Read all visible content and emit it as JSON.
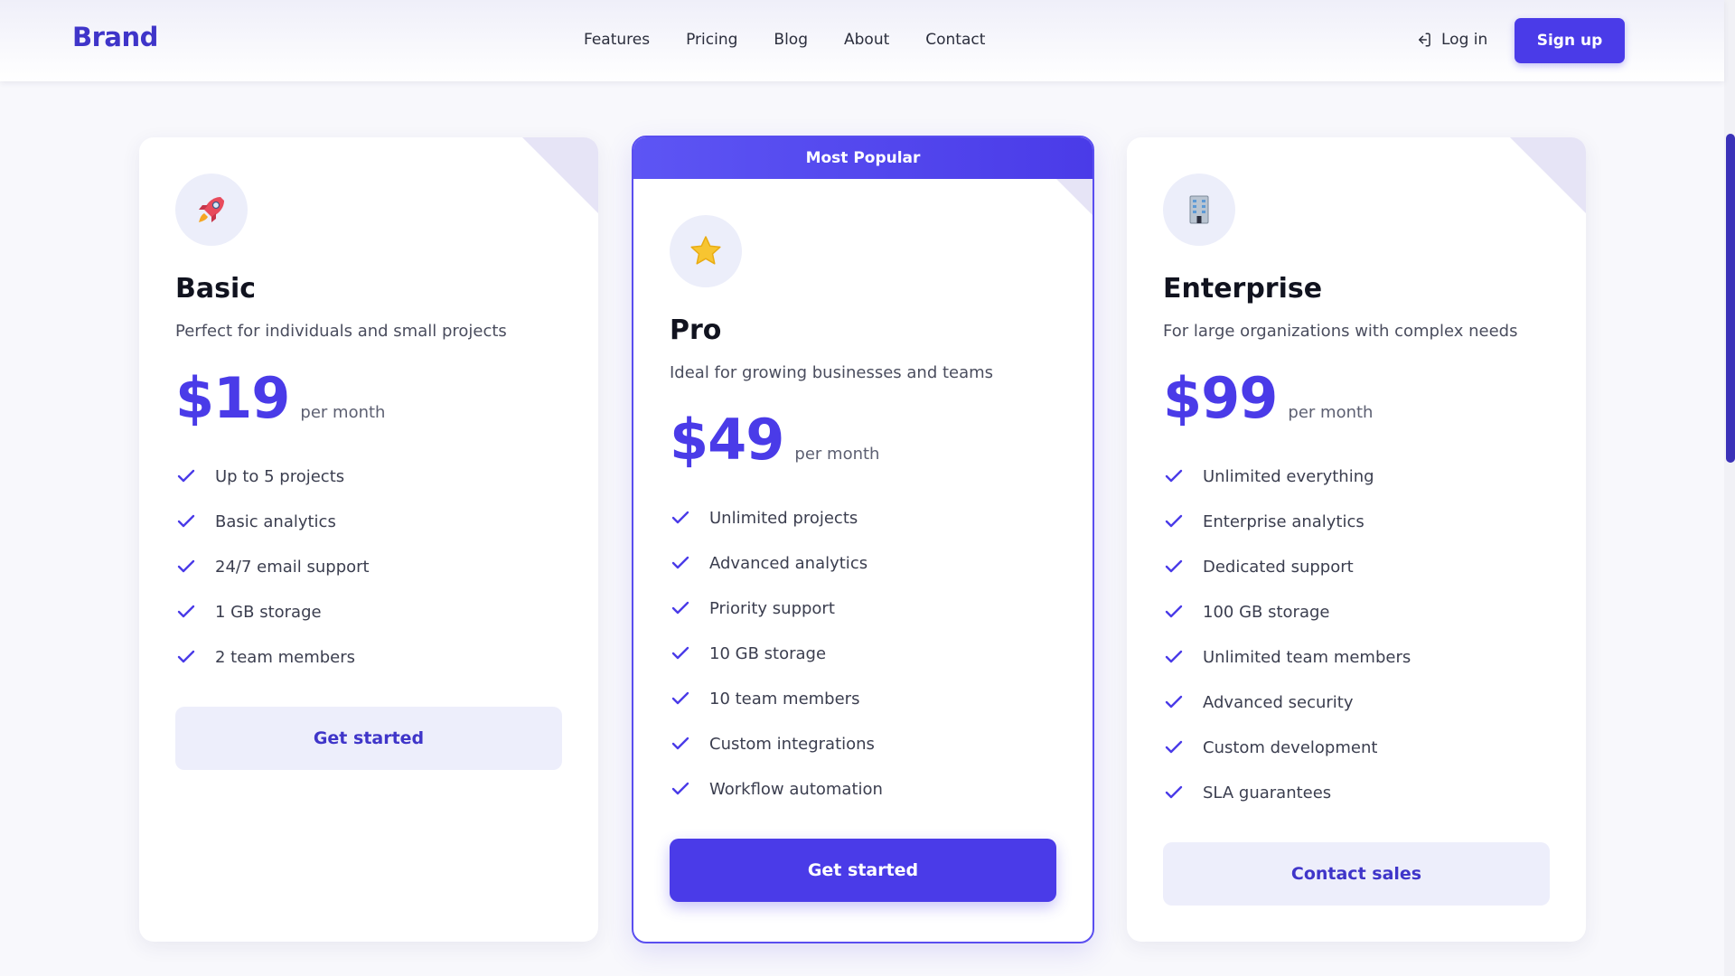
{
  "header": {
    "brand": "Brand",
    "nav": [
      "Features",
      "Pricing",
      "Blog",
      "About",
      "Contact"
    ],
    "login_label": "Log in",
    "signup_label": "Sign up"
  },
  "colors": {
    "accent": "#4a3be8",
    "accent_light": "#edeefb",
    "brand": "#3f35c9"
  },
  "plans": [
    {
      "icon": "rocket-icon",
      "name": "Basic",
      "description": "Perfect for individuals and small projects",
      "price": "$19",
      "period": "per month",
      "features": [
        "Up to 5 projects",
        "Basic analytics",
        "24/7 email support",
        "1 GB storage",
        "2 team members"
      ],
      "cta": "Get started"
    },
    {
      "badge": "Most Popular",
      "icon": "star-icon",
      "name": "Pro",
      "description": "Ideal for growing businesses and teams",
      "price": "$49",
      "period": "per month",
      "features": [
        "Unlimited projects",
        "Advanced analytics",
        "Priority support",
        "10 GB storage",
        "10 team members",
        "Custom integrations",
        "Workflow automation"
      ],
      "cta": "Get started"
    },
    {
      "icon": "building-icon",
      "name": "Enterprise",
      "description": "For large organizations with complex needs",
      "price": "$99",
      "period": "per month",
      "features": [
        "Unlimited everything",
        "Enterprise analytics",
        "Dedicated support",
        "100 GB storage",
        "Unlimited team members",
        "Advanced security",
        "Custom development",
        "SLA guarantees"
      ],
      "cta": "Contact sales"
    }
  ]
}
